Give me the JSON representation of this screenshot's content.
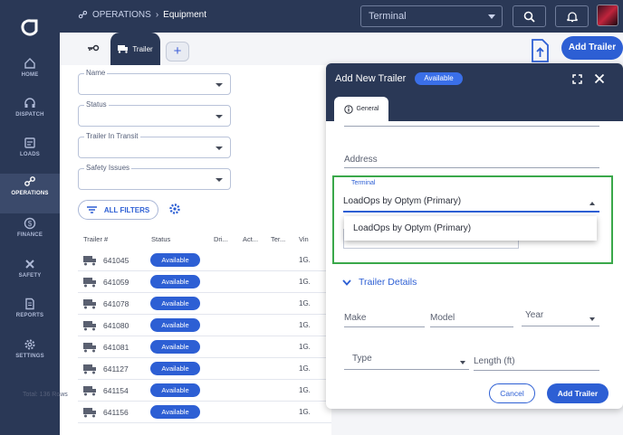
{
  "breadcrumb": {
    "section": "OPERATIONS",
    "page": "Equipment"
  },
  "topbar": {
    "terminal_value": "Terminal"
  },
  "sidebar": {
    "items": [
      {
        "label": "HOME",
        "icon": "home-icon"
      },
      {
        "label": "DISPATCH",
        "icon": "headset-icon"
      },
      {
        "label": "LOADS",
        "icon": "loads-icon"
      },
      {
        "label": "OPERATIONS",
        "icon": "operations-icon",
        "active": true
      },
      {
        "label": "FINANCE",
        "icon": "dollar-icon"
      },
      {
        "label": "SAFETY",
        "icon": "tools-icon"
      },
      {
        "label": "REPORTS",
        "icon": "report-icon"
      },
      {
        "label": "SETTINGS",
        "icon": "gear-icon"
      }
    ]
  },
  "tabs": {
    "trailer_label": "Trailer",
    "add_label": "+"
  },
  "actions": {
    "add_trailer": "Add Trailer"
  },
  "filters": {
    "name": "Name",
    "status": "Status",
    "in_transit": "Trailer In Transit",
    "safety": "Safety Issues",
    "all_filters": "ALL FILTERS"
  },
  "table": {
    "columns": [
      "Trailer #",
      "Status",
      "Dri...",
      "Act...",
      "Ter...",
      "Vin"
    ],
    "rows": [
      {
        "number": "641045",
        "status": "Available",
        "vin": "1G."
      },
      {
        "number": "641059",
        "status": "Available",
        "vin": "1G."
      },
      {
        "number": "641078",
        "status": "Available",
        "vin": "1G."
      },
      {
        "number": "641080",
        "status": "Available",
        "vin": "1G."
      },
      {
        "number": "641081",
        "status": "Available",
        "vin": "1G."
      },
      {
        "number": "641127",
        "status": "Available",
        "vin": "1G."
      },
      {
        "number": "641154",
        "status": "Available",
        "vin": "1G."
      },
      {
        "number": "641156",
        "status": "Available",
        "vin": "1G."
      }
    ],
    "total": "Total: 136 Rows"
  },
  "modal": {
    "title": "Add New Trailer",
    "status": "Available",
    "tab_general": "General",
    "address_label": "Address",
    "terminal_label": "Terminal",
    "terminal_value": "LoadOps by Optym (Primary)",
    "dropdown_option": "LoadOps by Optym (Primary)",
    "section_title": "Trailer Details",
    "make_label": "Make",
    "model_label": "Model",
    "year_label": "Year",
    "type_label": "Type",
    "length_label": "Length (ft)",
    "cancel_label": "Cancel",
    "save_label": "Add Trailer"
  },
  "colors": {
    "navy": "#2a3856",
    "accent": "#2d5fd4",
    "highlight": "#3aa84a"
  }
}
